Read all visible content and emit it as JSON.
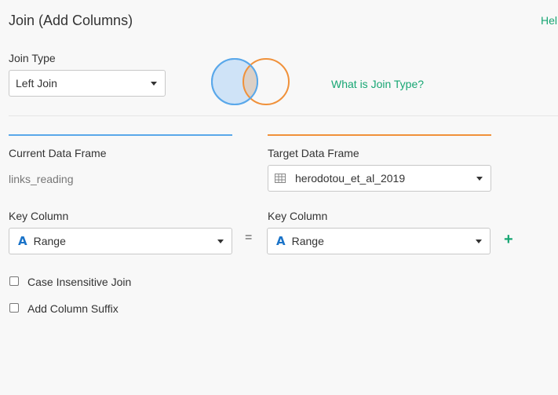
{
  "title": "Join (Add Columns)",
  "help_link": "Hel",
  "join_type": {
    "label": "Join Type",
    "selected": "Left Join",
    "info_link": "What is Join Type?"
  },
  "current": {
    "label": "Current Data Frame",
    "value": "links_reading",
    "key_label": "Key Column",
    "key_value": "Range"
  },
  "target": {
    "label": "Target Data Frame",
    "value": "herodotou_et_al_2019",
    "key_label": "Key Column",
    "key_value": "Range"
  },
  "equals": "=",
  "add_icon": "+",
  "options": {
    "case_insensitive": "Case Insensitive Join",
    "add_suffix": "Add Column Suffix"
  },
  "colors": {
    "accent_green": "#17a673",
    "current_blue": "#5aa8ea",
    "target_orange": "#f0913a"
  },
  "icons": {
    "venn": "venn-diagram-icon",
    "table": "table-icon",
    "string_type": "string-type-icon"
  }
}
